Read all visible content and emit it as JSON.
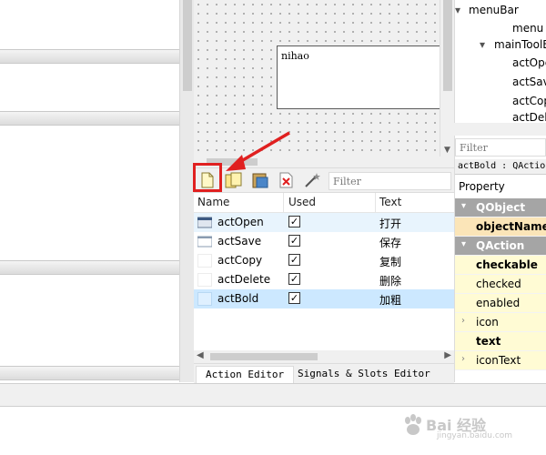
{
  "canvas": {
    "label_text": "nihao"
  },
  "toolbar": {
    "filter_placeholder": "Filter"
  },
  "table": {
    "columns": [
      "Name",
      "Used",
      "Text"
    ],
    "rows": [
      {
        "name": "actOpen",
        "used": true,
        "text": "打开",
        "icon": "open-file-icon"
      },
      {
        "name": "actSave",
        "used": true,
        "text": "保存",
        "icon": "save-icon"
      },
      {
        "name": "actCopy",
        "used": true,
        "text": "复制",
        "icon": "blank-icon"
      },
      {
        "name": "actDelete",
        "used": true,
        "text": "删除",
        "icon": "blank-icon"
      },
      {
        "name": "actBold",
        "used": true,
        "text": "加粗",
        "icon": "blank-icon"
      }
    ]
  },
  "tabs": [
    "Action Editor",
    "Signals & Slots Editor"
  ],
  "object_tree": {
    "items": [
      "menuBar",
      "menu",
      "mainToolB",
      "actOpe",
      "actSav",
      "actCop",
      "actDel"
    ]
  },
  "property_editor": {
    "filter_placeholder": "Filter",
    "path": "actBold : QAction",
    "header": "Property",
    "rows": [
      {
        "label": "QObject",
        "kind": "group"
      },
      {
        "label": "objectName",
        "kind": "name"
      },
      {
        "label": "QAction",
        "kind": "group"
      },
      {
        "label": "checkable",
        "kind": "bold"
      },
      {
        "label": "checked",
        "kind": "normal"
      },
      {
        "label": "enabled",
        "kind": "normal"
      },
      {
        "label": "icon",
        "kind": "expandable"
      },
      {
        "label": "text",
        "kind": "bold"
      },
      {
        "label": "iconText",
        "kind": "expandable"
      }
    ]
  },
  "watermark": {
    "text": "Bai 经验",
    "url": "jingyan.baidu.com"
  },
  "colors": {
    "highlight": "#e02020",
    "selection": "#cce8ff",
    "group_bg": "#a5a5a5",
    "name_bg": "#fbe5b8",
    "property_bg": "#fffbd4"
  }
}
